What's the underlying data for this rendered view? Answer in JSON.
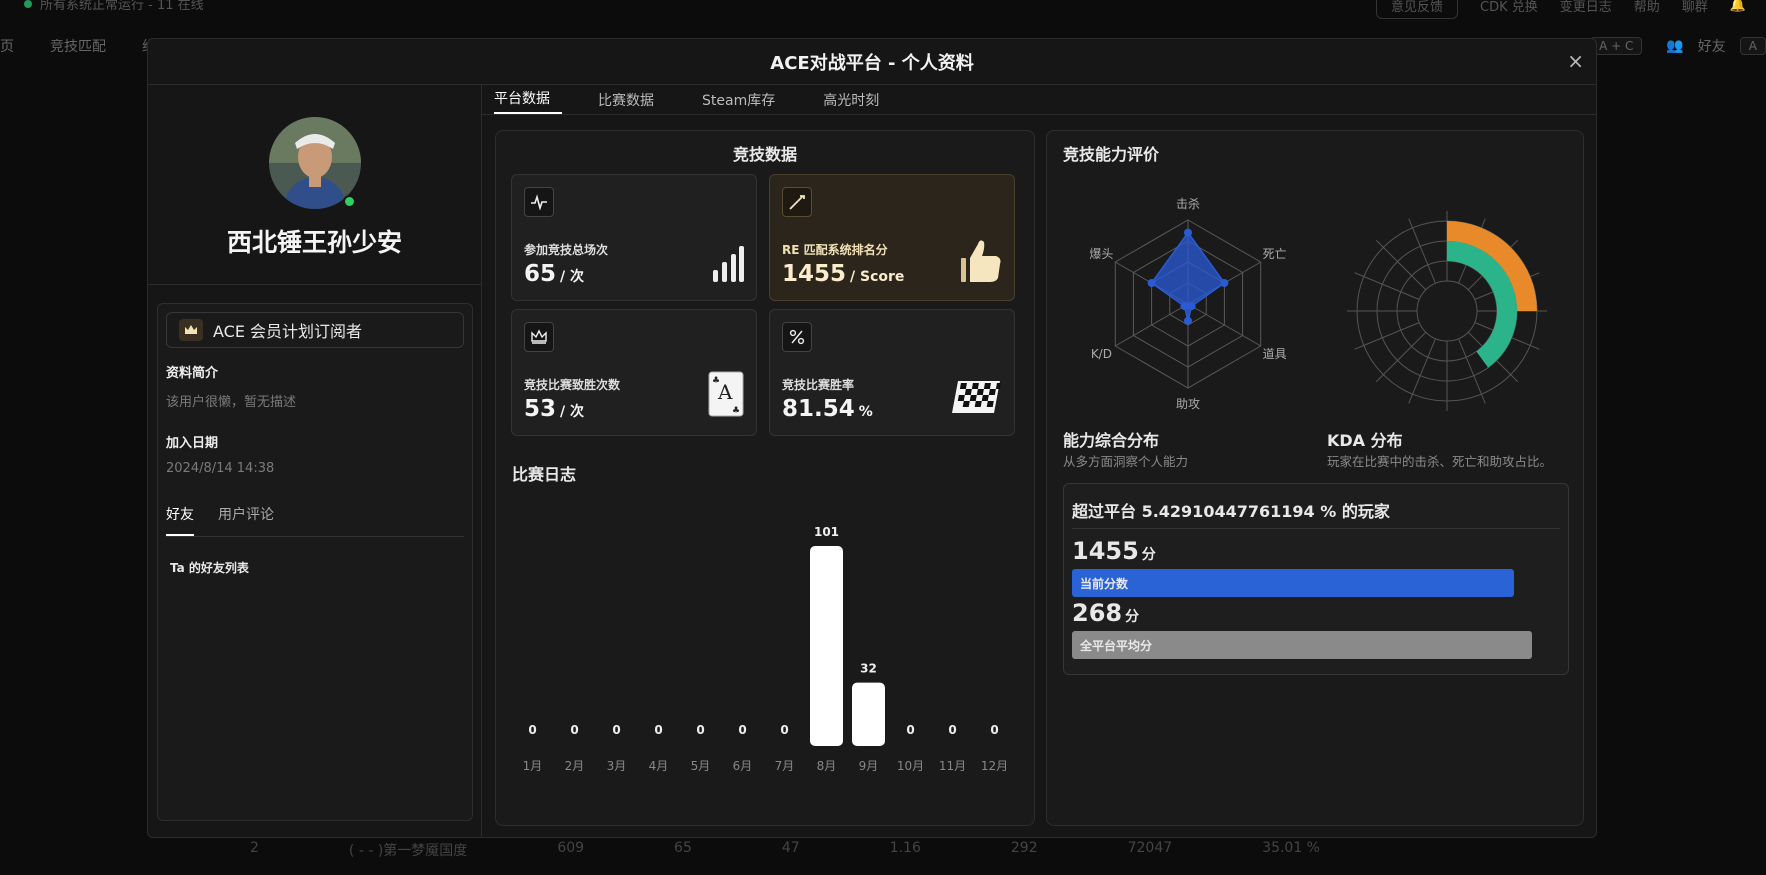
{
  "background": {
    "status_text": "所有系统正常运行 - 11 在线",
    "feedback_button": "意见反馈",
    "cdk_button": "CDK 兑换",
    "changelog_link": "变更日志",
    "help_link": "帮助",
    "chat_group_link": "聊群",
    "nav_items": [
      "页",
      "竞技匹配",
      "组"
    ],
    "chat_label": "聊天",
    "chat_shortcut": "A + C",
    "friends_label": "好友",
    "friends_shortcut": "A",
    "row": [
      "2",
      "( - - )第一梦魇国度",
      "609",
      "65",
      "47",
      "1.16",
      "292",
      "72047",
      "35.01 %"
    ]
  },
  "modal": {
    "title": "ACE对战平台 - 个人资料",
    "close_symbol": "×"
  },
  "profile": {
    "username": "西北锤王孙少安",
    "membership": "ACE 会员计划订阅者",
    "bio_label": "资料简介",
    "bio_value": "该用户很懒，暂无描述",
    "join_label": "加入日期",
    "join_value": "2024/8/14 14:38",
    "tabs": [
      "好友",
      "用户评论"
    ],
    "friends_list_title": "Ta 的好友列表"
  },
  "tabs": [
    "平台数据",
    "比赛数据",
    "Steam库存",
    "高光时刻"
  ],
  "stats": {
    "title": "竞技数据",
    "cards": [
      {
        "label": "参加竞技总场次",
        "value": "65",
        "unit": "/ 次"
      },
      {
        "label": "RE 匹配系统排名分",
        "value": "1455",
        "unit": "/ Score"
      },
      {
        "label": "竞技比赛致胜次数",
        "value": "53",
        "unit": "/ 次"
      },
      {
        "label": "竞技比赛胜率",
        "value": "81.54",
        "unit": "%"
      }
    ]
  },
  "match_log": {
    "title": "比赛日志"
  },
  "chart_data": [
    {
      "type": "bar",
      "title": "比赛日志",
      "categories": [
        "1月",
        "2月",
        "3月",
        "4月",
        "5月",
        "6月",
        "7月",
        "8月",
        "9月",
        "10月",
        "11月",
        "12月"
      ],
      "values": [
        0,
        0,
        0,
        0,
        0,
        0,
        0,
        101,
        32,
        0,
        0,
        0
      ],
      "ylim": [
        0,
        101
      ],
      "color": "#ffffff"
    },
    {
      "type": "radar",
      "title": "竞技能力评价",
      "categories": [
        "击杀",
        "死亡",
        "道具",
        "助攻",
        "K/D",
        "爆头"
      ],
      "values": [
        0.85,
        0.5,
        0.05,
        0.2,
        0.05,
        0.5
      ],
      "color": "#2a5bd7"
    },
    {
      "type": "pie",
      "title": "KDA 分布",
      "categories": [
        "击杀",
        "死亡",
        "助攻"
      ],
      "values": [
        0.25,
        0.4,
        1.0
      ],
      "colors": [
        "#e8892a",
        "#2bb38a",
        "#2a5bd7"
      ]
    }
  ],
  "ability": {
    "title": "竞技能力评价",
    "radar_title": "能力综合分布",
    "radar_desc": "从多方面洞察个人能力",
    "kda_title": "KDA 分布",
    "kda_desc": "玩家在比赛中的击杀、死亡和助攻占比。"
  },
  "exceed": {
    "title": "超过平台 5.42910447761194 % 的玩家",
    "current_score": "1455",
    "current_unit": "分",
    "current_label": "当前分数",
    "current_fraction": 0.94,
    "average_score": "268",
    "average_unit": "分",
    "average_label": "全平台平均分",
    "average_fraction": 0.99,
    "current_color": "#2a63d6",
    "average_color": "#8a8a8a"
  }
}
